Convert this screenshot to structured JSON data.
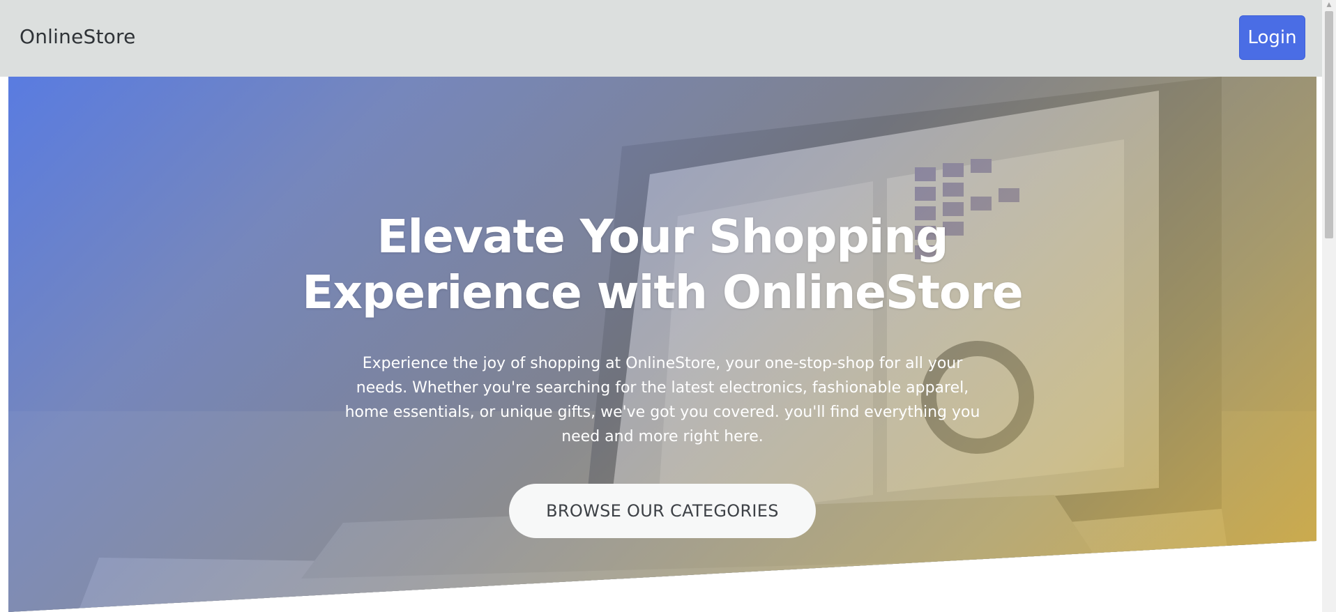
{
  "navbar": {
    "brand": "OnlineStore",
    "login_label": "Login"
  },
  "hero": {
    "title_line1": "Elevate Your Shopping",
    "title_line2": "Experience with OnlineStore",
    "description": "Experience the joy of shopping at OnlineStore, your one-stop-shop for all your needs. Whether you're searching for the latest electronics, fashionable apparel, home essentials, or unique gifts, we've got you covered. you'll find everything you need and more right here.",
    "cta_label": "BROWSE OUR CATEGORIES"
  },
  "icons": {
    "scroll_up": "triangle-up-icon"
  },
  "colors": {
    "navbar_bg": "#dcdfde",
    "login_bg": "#4a6de5",
    "gradient_start": "#587ce6",
    "gradient_end": "#d7af41",
    "cta_bg": "#f7f8f8"
  }
}
